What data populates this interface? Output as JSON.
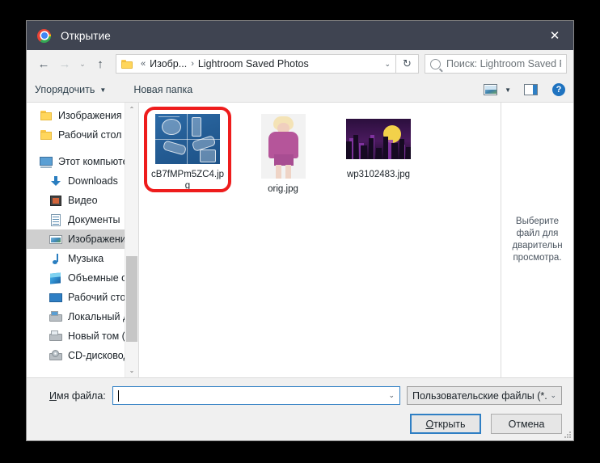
{
  "window": {
    "title": "Открытие",
    "app_icon": "chrome-logo-icon",
    "close_label": "✕"
  },
  "nav": {
    "back": "←",
    "forward": "→",
    "history": "⌄",
    "up": "↑",
    "breadcrumb": {
      "overflow": "«",
      "parent": "Изобр...",
      "separator": "›",
      "current": "Lightroom Saved Photos",
      "caret": "⌄"
    },
    "refresh": "↻",
    "search": {
      "placeholder": "Поиск: Lightroom Saved Ph...",
      "icon": "search-icon"
    }
  },
  "toolbar": {
    "organize": "Упорядочить",
    "organize_caret": "▼",
    "new_folder": "Новая папка",
    "view_caret": "▼",
    "help_glyph": "?"
  },
  "sidebar": {
    "scroll_up": "⌃",
    "scroll_down": "⌄",
    "items": [
      {
        "label": "Изображения",
        "icon": "folder-icon",
        "group": "quick",
        "selected": false
      },
      {
        "label": "Рабочий стол",
        "icon": "folder-icon",
        "group": "quick",
        "selected": false
      },
      {
        "label": "Этот компьютер",
        "icon": "this-pc-icon",
        "group": "pc",
        "selected": false
      },
      {
        "label": "Downloads",
        "icon": "downloads-icon",
        "group": "pc-child",
        "selected": false
      },
      {
        "label": "Видео",
        "icon": "video-icon",
        "group": "pc-child",
        "selected": false
      },
      {
        "label": "Документы",
        "icon": "documents-icon",
        "group": "pc-child",
        "selected": false
      },
      {
        "label": "Изображения",
        "icon": "pictures-icon",
        "group": "pc-child",
        "selected": true
      },
      {
        "label": "Музыка",
        "icon": "music-icon",
        "group": "pc-child",
        "selected": false
      },
      {
        "label": "Объемные объ",
        "icon": "3d-objects-icon",
        "group": "pc-child",
        "selected": false
      },
      {
        "label": "Рабочий стол",
        "icon": "desktop-icon",
        "group": "pc-child",
        "selected": false
      },
      {
        "label": "Локальный дис",
        "icon": "local-disk-icon",
        "group": "pc-child",
        "selected": false
      },
      {
        "label": "Новый том (D:)",
        "icon": "drive-icon",
        "group": "pc-child",
        "selected": false
      },
      {
        "label": "CD-дисковод (F",
        "icon": "cd-drive-icon",
        "group": "pc-child",
        "selected": false
      }
    ]
  },
  "files": [
    {
      "name": "cB7fMPm5ZC4.jpg",
      "type": "blueprint-thumbnail",
      "highlighted": true
    },
    {
      "name": "orig.jpg",
      "type": "portrait-thumbnail",
      "highlighted": false
    },
    {
      "name": "wp3102483.jpg",
      "type": "cityscape-thumbnail",
      "highlighted": false
    }
  ],
  "preview": {
    "line1": "Выберите",
    "line2": "файл для",
    "line3": "дварительн",
    "line4": "просмотра."
  },
  "footer": {
    "filename_label_prefix": "И",
    "filename_label_rest": "мя файла:",
    "filename_value": "",
    "filename_caret": "⌄",
    "filetype_value": "Пользовательские файлы (*.jf",
    "filetype_caret": "⌄",
    "open_prefix": "О",
    "open_rest": "ткрыть",
    "cancel": "Отмена"
  },
  "colors": {
    "titlebar": "#3f4451",
    "accent": "#2f7fc4",
    "highlight": "#ee1c1c",
    "selection": "#cfcfcf"
  }
}
